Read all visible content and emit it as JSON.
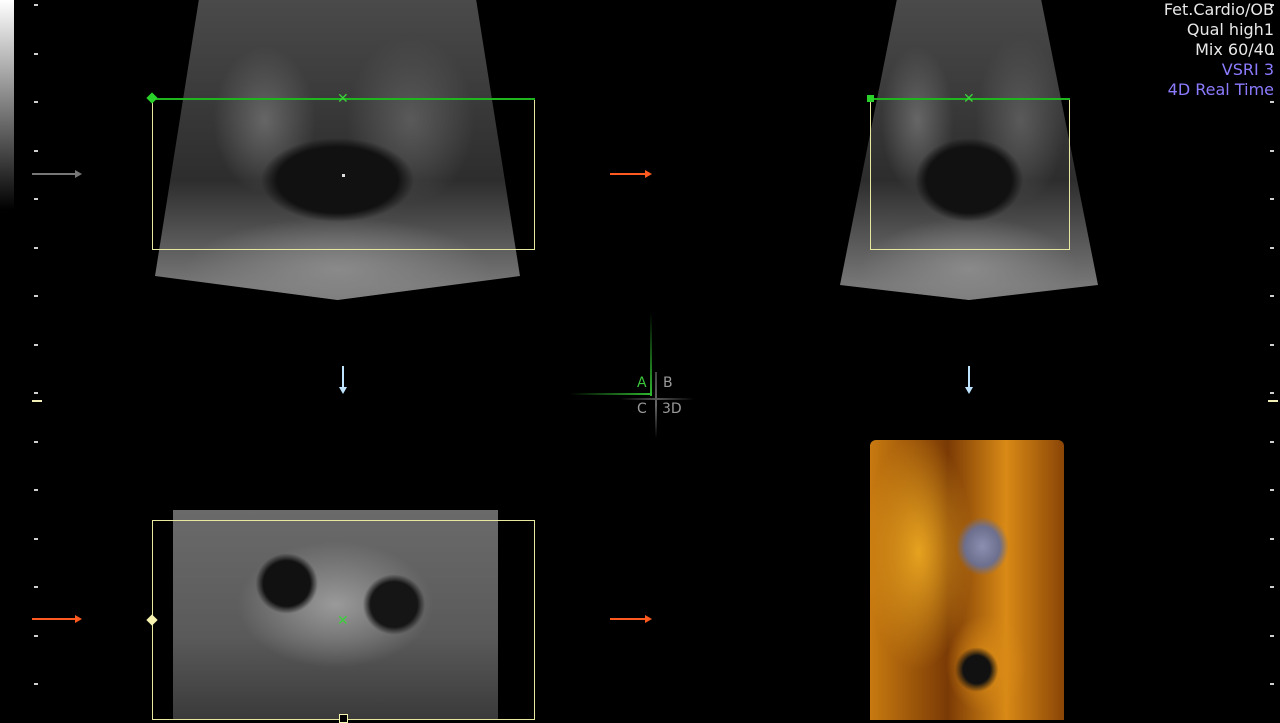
{
  "info_panel": {
    "preset": "Fet.Cardio/OB",
    "quality": "Qual high1",
    "mix": "Mix 60/40",
    "vsri": "VSRI 3",
    "mode": "4D Real Time"
  },
  "quadrant_labels": {
    "a": "A",
    "b": "B",
    "c": "C",
    "d": "3D"
  },
  "colors": {
    "info_text": "#e8e8e8",
    "info_highlight": "#8b7cff",
    "roi_border": "#e7e7a0",
    "roi_top": "#1fb51f",
    "plane_marker": "#3ad13a",
    "orange_arrow": "#ff5a1f",
    "blue_arrow": "#bfe4ff"
  },
  "icons": {
    "plane_marker": "x-marker-icon",
    "orientation_arrow": "arrow-right-icon",
    "down_arrow": "arrow-down-icon"
  }
}
